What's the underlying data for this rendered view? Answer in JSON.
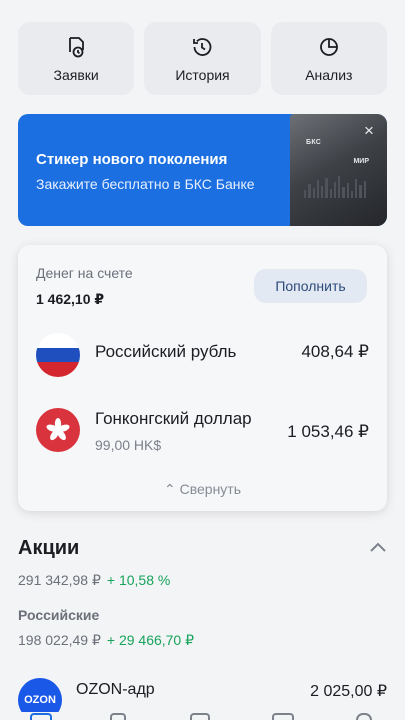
{
  "quick_actions": [
    {
      "label": "Заявки",
      "icon": "requests-icon"
    },
    {
      "label": "История",
      "icon": "history-icon"
    },
    {
      "label": "Анализ",
      "icon": "analysis-icon"
    }
  ],
  "promo": {
    "title": "Стикер нового поколения",
    "subtitle": "Закажите бесплатно в БКС Банке",
    "card_brand": "БКС",
    "card_mir": "МИР",
    "background": "#1b6fe0"
  },
  "balance": {
    "label": "Денег на счете",
    "amount": "1 462,10 ₽",
    "topup_label": "Пополнить",
    "currencies": [
      {
        "name": "Российский рубль",
        "value": "408,64 ₽",
        "sub": "",
        "flag": "russia-flag-icon"
      },
      {
        "name": "Гонконгский доллар",
        "value": "1 053,46 ₽",
        "sub": "99,00 HK$",
        "flag": "hong-kong-flag-icon"
      }
    ],
    "collapse_label": "Свернуть"
  },
  "stocks": {
    "title": "Акции",
    "total": "291 342,98 ₽",
    "total_gain": "+ 10,58 %",
    "ru_label": "Российские",
    "ru_total": "198 022,49 ₽",
    "ru_gain": "+ 29 466,70 ₽",
    "items": [
      {
        "logo": "OZON",
        "name": "OZON-адр",
        "value": "2 025,00 ₽"
      }
    ]
  },
  "colors": {
    "accent": "#1b6fe0",
    "positive": "#17a35b",
    "ozon": "#1a58e8"
  }
}
